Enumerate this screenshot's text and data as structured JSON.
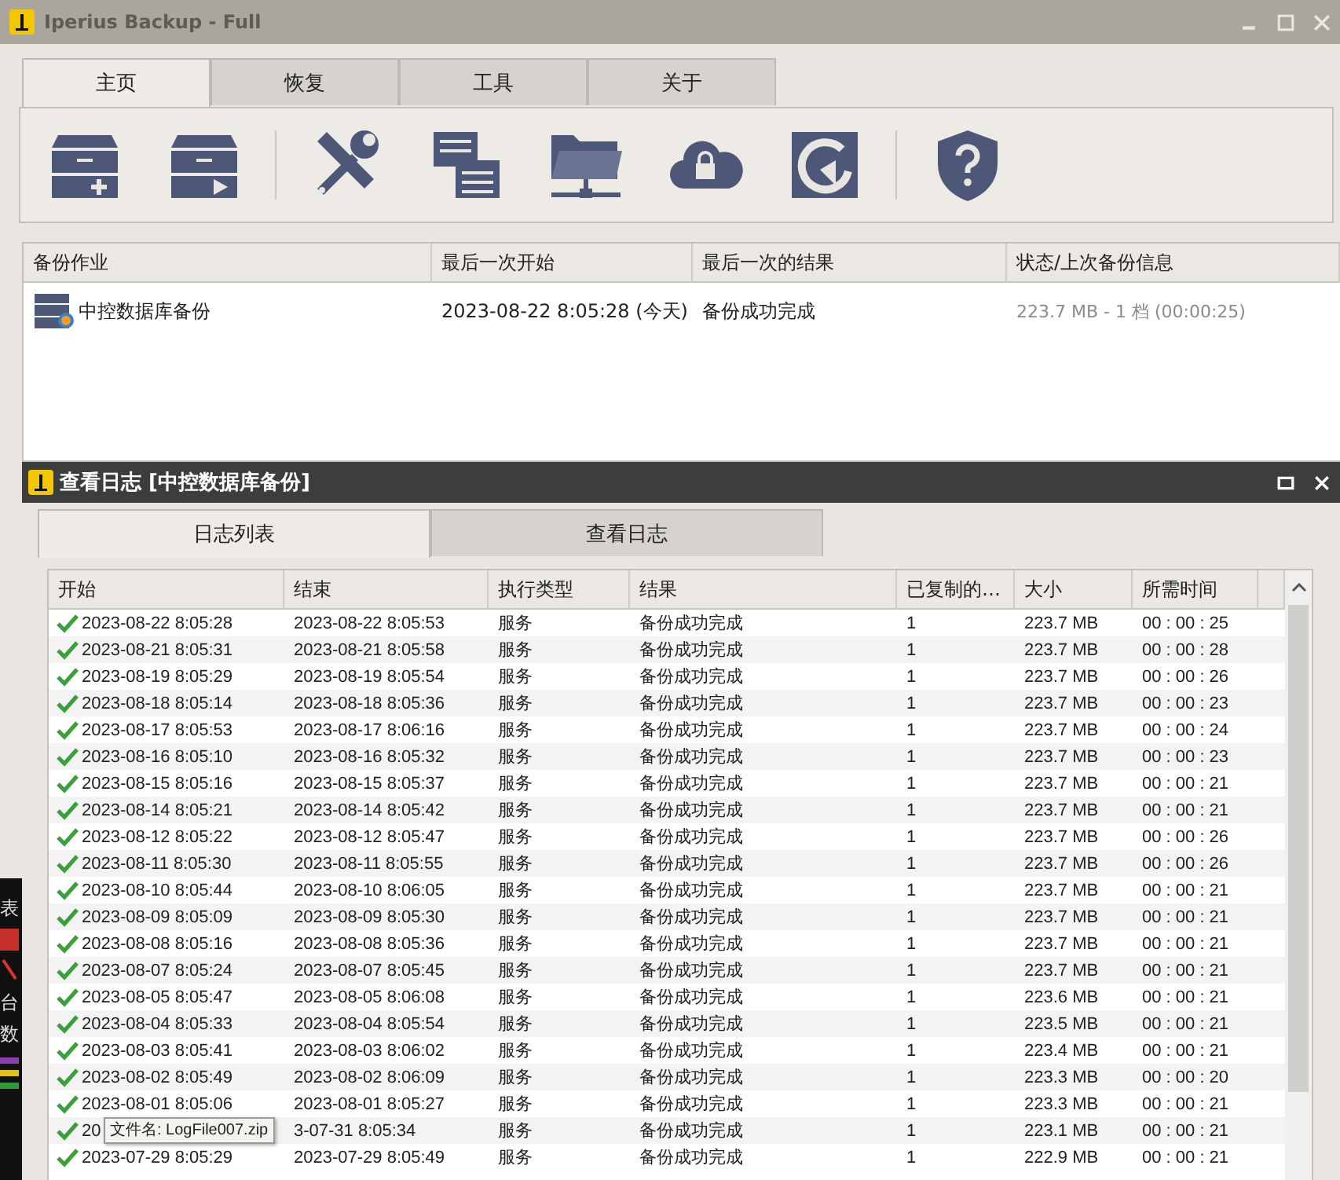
{
  "window": {
    "title": "Iperius Backup - Full"
  },
  "tabs": [
    {
      "label": "主页",
      "selected": true
    },
    {
      "label": "恢复",
      "selected": false
    },
    {
      "label": "工具",
      "selected": false
    },
    {
      "label": "关于",
      "selected": false
    }
  ],
  "jobs": {
    "columns": [
      "备份作业",
      "最后一次开始",
      "最后一次的结果",
      "状态/上次备份信息"
    ],
    "rows": [
      {
        "name": "中控数据库备份",
        "last_start": "2023-08-22 8:05:28 (今天)",
        "last_result": "备份成功完成",
        "status": "223.7 MB - 1 档 (00:00:25)"
      }
    ]
  },
  "desktop_fragments": [
    "表",
    "台",
    "数"
  ],
  "log_window": {
    "title": "查看日志 [中控数据库备份]",
    "tabs": [
      {
        "label": "日志列表",
        "selected": true
      },
      {
        "label": "查看日志",
        "selected": false
      }
    ],
    "columns": [
      "开始",
      "结束",
      "执行类型",
      "结果",
      "已复制的…",
      "大小",
      "所需时间"
    ],
    "rows": [
      {
        "start": "2023-08-22 8:05:28",
        "end": "2023-08-22 8:05:53",
        "type": "服务",
        "result": "备份成功完成",
        "copied": "1",
        "size": "223.7 MB",
        "duration": "00 : 00 : 25"
      },
      {
        "start": "2023-08-21 8:05:31",
        "end": "2023-08-21 8:05:58",
        "type": "服务",
        "result": "备份成功完成",
        "copied": "1",
        "size": "223.7 MB",
        "duration": "00 : 00 : 28"
      },
      {
        "start": "2023-08-19 8:05:29",
        "end": "2023-08-19 8:05:54",
        "type": "服务",
        "result": "备份成功完成",
        "copied": "1",
        "size": "223.7 MB",
        "duration": "00 : 00 : 26"
      },
      {
        "start": "2023-08-18 8:05:14",
        "end": "2023-08-18 8:05:36",
        "type": "服务",
        "result": "备份成功完成",
        "copied": "1",
        "size": "223.7 MB",
        "duration": "00 : 00 : 23"
      },
      {
        "start": "2023-08-17 8:05:53",
        "end": "2023-08-17 8:06:16",
        "type": "服务",
        "result": "备份成功完成",
        "copied": "1",
        "size": "223.7 MB",
        "duration": "00 : 00 : 24"
      },
      {
        "start": "2023-08-16 8:05:10",
        "end": "2023-08-16 8:05:32",
        "type": "服务",
        "result": "备份成功完成",
        "copied": "1",
        "size": "223.7 MB",
        "duration": "00 : 00 : 23"
      },
      {
        "start": "2023-08-15 8:05:16",
        "end": "2023-08-15 8:05:37",
        "type": "服务",
        "result": "备份成功完成",
        "copied": "1",
        "size": "223.7 MB",
        "duration": "00 : 00 : 21"
      },
      {
        "start": "2023-08-14 8:05:21",
        "end": "2023-08-14 8:05:42",
        "type": "服务",
        "result": "备份成功完成",
        "copied": "1",
        "size": "223.7 MB",
        "duration": "00 : 00 : 21"
      },
      {
        "start": "2023-08-12 8:05:22",
        "end": "2023-08-12 8:05:47",
        "type": "服务",
        "result": "备份成功完成",
        "copied": "1",
        "size": "223.7 MB",
        "duration": "00 : 00 : 26"
      },
      {
        "start": "2023-08-11 8:05:30",
        "end": "2023-08-11 8:05:55",
        "type": "服务",
        "result": "备份成功完成",
        "copied": "1",
        "size": "223.7 MB",
        "duration": "00 : 00 : 26"
      },
      {
        "start": "2023-08-10 8:05:44",
        "end": "2023-08-10 8:06:05",
        "type": "服务",
        "result": "备份成功完成",
        "copied": "1",
        "size": "223.7 MB",
        "duration": "00 : 00 : 21"
      },
      {
        "start": "2023-08-09 8:05:09",
        "end": "2023-08-09 8:05:30",
        "type": "服务",
        "result": "备份成功完成",
        "copied": "1",
        "size": "223.7 MB",
        "duration": "00 : 00 : 21"
      },
      {
        "start": "2023-08-08 8:05:16",
        "end": "2023-08-08 8:05:36",
        "type": "服务",
        "result": "备份成功完成",
        "copied": "1",
        "size": "223.7 MB",
        "duration": "00 : 00 : 21"
      },
      {
        "start": "2023-08-07 8:05:24",
        "end": "2023-08-07 8:05:45",
        "type": "服务",
        "result": "备份成功完成",
        "copied": "1",
        "size": "223.7 MB",
        "duration": "00 : 00 : 21"
      },
      {
        "start": "2023-08-05 8:05:47",
        "end": "2023-08-05 8:06:08",
        "type": "服务",
        "result": "备份成功完成",
        "copied": "1",
        "size": "223.6 MB",
        "duration": "00 : 00 : 21"
      },
      {
        "start": "2023-08-04 8:05:33",
        "end": "2023-08-04 8:05:54",
        "type": "服务",
        "result": "备份成功完成",
        "copied": "1",
        "size": "223.5 MB",
        "duration": "00 : 00 : 21"
      },
      {
        "start": "2023-08-03 8:05:41",
        "end": "2023-08-03 8:06:02",
        "type": "服务",
        "result": "备份成功完成",
        "copied": "1",
        "size": "223.4 MB",
        "duration": "00 : 00 : 21"
      },
      {
        "start": "2023-08-02 8:05:49",
        "end": "2023-08-02 8:06:09",
        "type": "服务",
        "result": "备份成功完成",
        "copied": "1",
        "size": "223.3 MB",
        "duration": "00 : 00 : 20"
      },
      {
        "start": "2023-08-01 8:05:06",
        "end": "2023-08-01 8:05:27",
        "type": "服务",
        "result": "备份成功完成",
        "copied": "1",
        "size": "223.3 MB",
        "duration": "00 : 00 : 21"
      },
      {
        "start": "20",
        "end": "3-07-31 8:05:34",
        "type": "服务",
        "result": "备份成功完成",
        "copied": "1",
        "size": "223.1 MB",
        "duration": "00 : 00 : 21"
      },
      {
        "start": "2023-07-29 8:05:29",
        "end": "2023-07-29 8:05:49",
        "type": "服务",
        "result": "备份成功完成",
        "copied": "1",
        "size": "222.9 MB",
        "duration": "00 : 00 : 21"
      }
    ],
    "tooltip": "文件名: LogFile007.zip"
  }
}
